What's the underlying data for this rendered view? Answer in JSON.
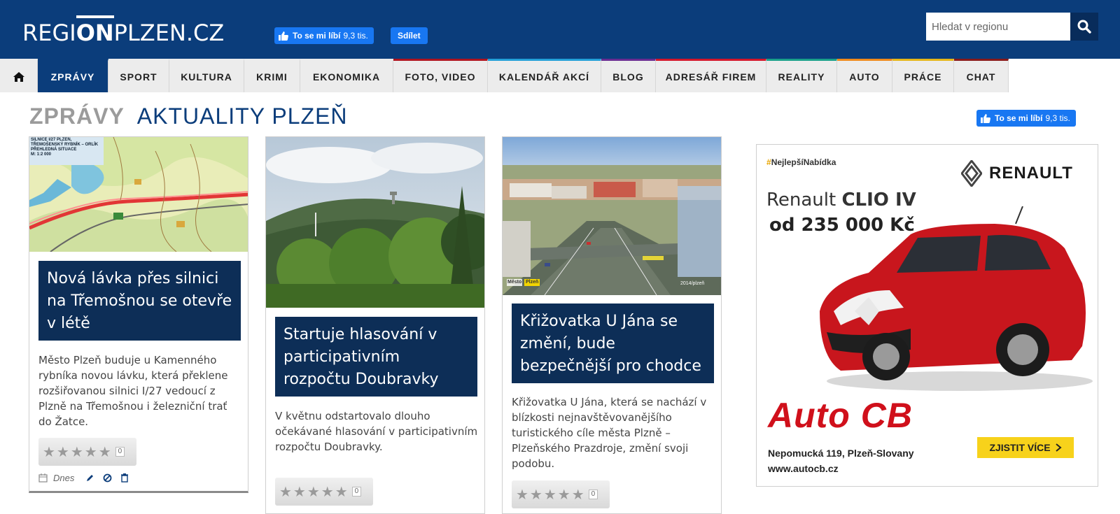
{
  "header": {
    "logo_pre": "REGI",
    "logo_bold": "ON",
    "logo_post": "PLZEN.CZ",
    "fb_like_label": "To se mi líbí",
    "fb_like_count": "9,3 tis.",
    "fb_share_label": "Sdílet",
    "search_placeholder": "Hledat v regionu"
  },
  "nav": {
    "items": [
      {
        "label": "ZPRÁVY",
        "accent": "#0b3d7b"
      },
      {
        "label": "SPORT",
        "accent": "#ececec"
      },
      {
        "label": "KULTURA",
        "accent": "#ececec"
      },
      {
        "label": "KRIMI",
        "accent": "#ececec"
      },
      {
        "label": "EKONOMIKA",
        "accent": "#ececec"
      },
      {
        "label": "FOTO, VIDEO",
        "accent": "#b0151f"
      },
      {
        "label": "KALENDÁŘ AKCÍ",
        "accent": "#24a0d8"
      },
      {
        "label": "BLOG",
        "accent": "#6a2c91"
      },
      {
        "label": "ADRESÁŘ FIREM",
        "accent": "#d4172b"
      },
      {
        "label": "REALITY",
        "accent": "#1aa18a"
      },
      {
        "label": "AUTO",
        "accent": "#f08a1c"
      },
      {
        "label": "PRÁCE",
        "accent": "#e6b619"
      },
      {
        "label": "CHAT",
        "accent": "#8a1a1a"
      }
    ]
  },
  "section": {
    "title": "ZPRÁVY",
    "subtitle": "AKTUALITY PLZEŇ",
    "fb_like_label": "To se mi líbí",
    "fb_like_count": "9,3 tis."
  },
  "articles": [
    {
      "title": "Nová lávka přes silnici na Třemošnou se otevře v létě",
      "perex": "Město Plzeň buduje u Kamenného rybníka novou lávku, která překlene rozšiřovanou silnici I/27 vedoucí z Plzně na Třemošnou i železniční trať do Žatce.",
      "rating_count": "0",
      "date": "Dnes",
      "map_label_1": "SILNICE I/27 PLZEŇ,",
      "map_label_2": "TŘEMOŠENSKÝ RYBNÍK – ORLÍK",
      "map_label_3": "PŘEHLEDNÁ SITUACE",
      "map_label_4": "M: 1:2 000"
    },
    {
      "title": "Startuje hlasování v participativním rozpočtu Doubravky",
      "perex": "V květnu odstartovalo dlouho očekávané hlasování v participativním rozpočtu Doubravky.",
      "rating_count": "0"
    },
    {
      "title": "Křižovatka U Jána se změní, bude bezpečnější pro chodce",
      "perex": "Křižovatka U Jána, která se nachází v blízkosti nejnavštěvovanějšího turistického cíle města Plzně – Plzeňského Prazdroje, změní svoji podobu.",
      "rating_count": "0",
      "photo_watermark_1": "Město",
      "photo_watermark_2": "Plzeň",
      "photo_watermark_3": "2014/plzeň"
    }
  ],
  "ad": {
    "tag_hash": "#",
    "tag_text": "NejlepšíNabídka",
    "brand": "RENAULT",
    "model_pre": "Renault ",
    "model_bold": "CLIO IV",
    "price": "od 235 000 Kč",
    "dealer": "Auto CB",
    "address_line1": "Nepomucká 119, Plzeň-Slovany",
    "address_line2": "www.autocb.cz",
    "cta": "ZJISTIT VÍCE"
  },
  "colors": {
    "brand_blue": "#0b3d7b",
    "title_box": "#0d2e57",
    "fb_blue": "#1877f2",
    "ad_red": "#d0101b",
    "cta_yellow": "#f7d21b"
  }
}
